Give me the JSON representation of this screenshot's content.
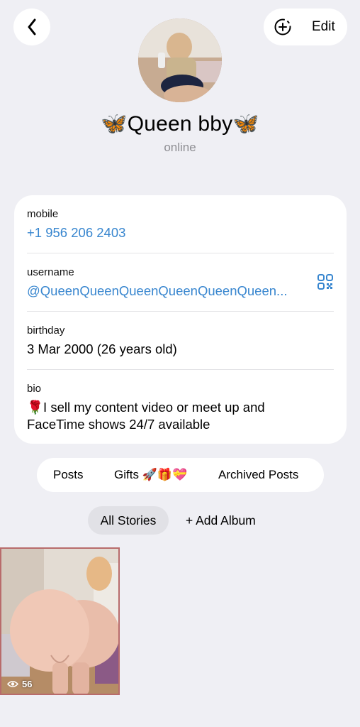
{
  "profile": {
    "name": "🦋Queen bby🦋",
    "status": "online"
  },
  "header": {
    "back_icon": "chevron-left-icon",
    "add_story_icon": "plus-circle-dashed-icon",
    "edit_label": "Edit"
  },
  "info": {
    "mobile_label": "mobile",
    "mobile_value": "+1 956 206 2403",
    "username_label": "username",
    "username_value": "@QueenQueenQueenQueenQueenQueen...",
    "birthday_label": "birthday",
    "birthday_value": "3 Mar 2000 (26 years old)",
    "bio_label": "bio",
    "bio_value": "🌹I sell my content video or meet up and FaceTime shows 24/7 available"
  },
  "tabs": {
    "posts": "Posts",
    "gifts": "Gifts 🚀🎁💝",
    "archived": "Archived Posts"
  },
  "stories": {
    "all_label": "All Stories",
    "add_album_label": "+ Add Album",
    "item_views": "56"
  },
  "colors": {
    "background": "#efeff4",
    "link": "#3886cf",
    "secondary_text": "#8e8e93"
  }
}
